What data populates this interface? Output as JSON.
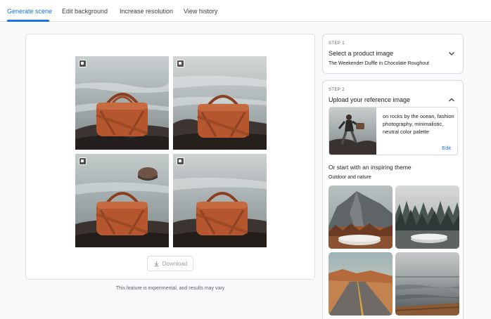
{
  "tabs": [
    {
      "label": "Generate scene",
      "active": true
    },
    {
      "label": "Edit background",
      "active": false
    },
    {
      "label": "Increase resolution",
      "active": false
    },
    {
      "label": "View history",
      "active": false
    }
  ],
  "results": {
    "tiles": [
      {
        "name": "result-1",
        "selected": false
      },
      {
        "name": "result-2",
        "selected": false
      },
      {
        "name": "result-3",
        "selected": false
      },
      {
        "name": "result-4",
        "selected": false
      }
    ],
    "download_label": "Download",
    "disclaimer": "This feature is experimental, and results may vary"
  },
  "step1": {
    "label": "STEP 1",
    "title": "Select a product image",
    "value": "The Weekender Duffle in Chocolate Roughout"
  },
  "step2": {
    "label": "STEP 2",
    "title": "Upload your reference image",
    "reference_prompt": "on rocks by the ocean, fashion photography, minimalistic, neutral color palette",
    "edit_label": "Edit",
    "themes_title": "Or start with an inspiring theme",
    "themes_category": "Outdoor and nature"
  },
  "colors": {
    "accent": "#1a73e8",
    "bag": "#b5562f"
  }
}
